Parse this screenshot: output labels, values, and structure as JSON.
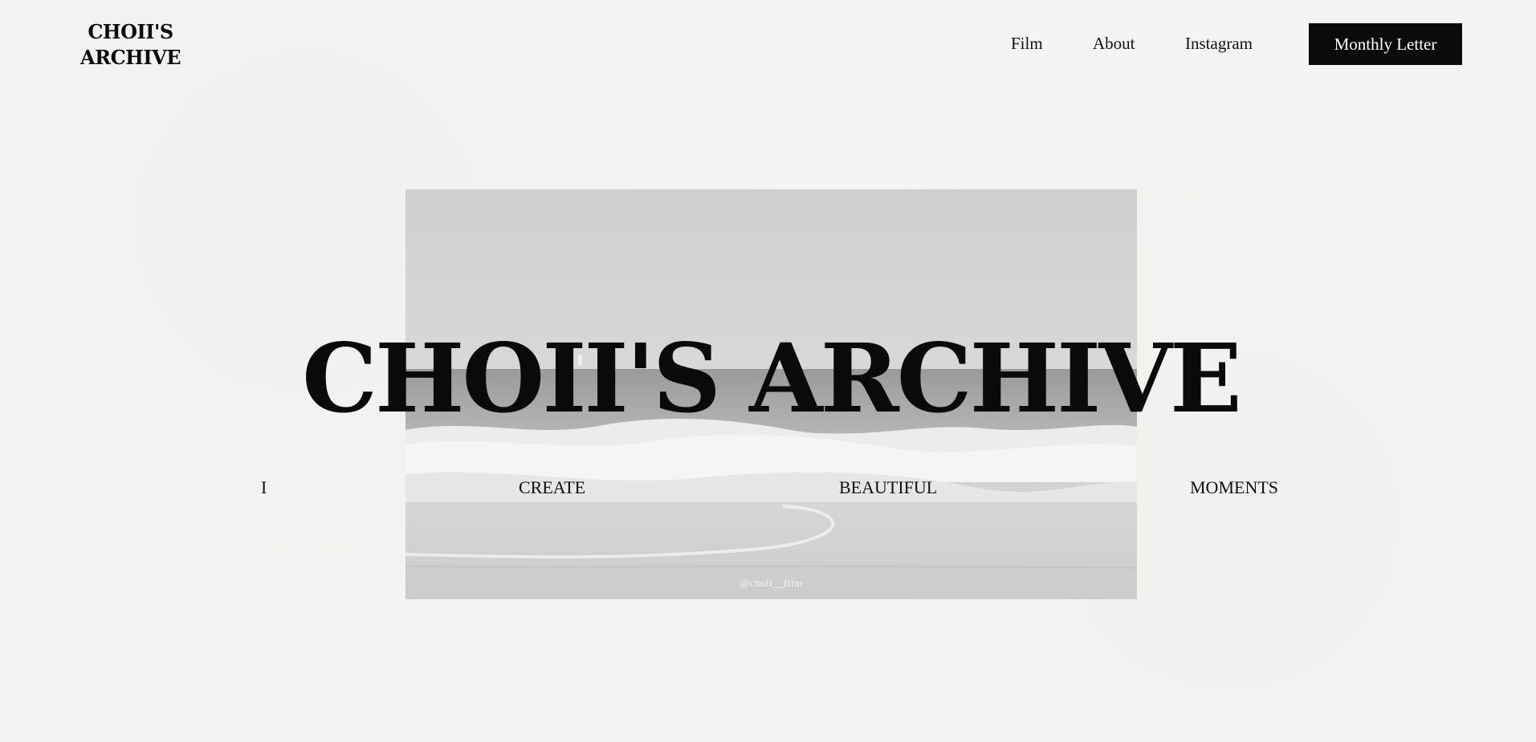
{
  "site": {
    "logo_line1": "CHOII'S",
    "logo_line2": "ARCHIVE"
  },
  "nav": {
    "items": [
      {
        "label": "Film"
      },
      {
        "label": "About"
      },
      {
        "label": "Instagram"
      }
    ],
    "cta_label": "Monthly Letter"
  },
  "hero": {
    "title": "CHOII'S ARCHIVE",
    "tagline_words": [
      "I",
      "CREATE",
      "BEAUTIFUL",
      "MOMENTS"
    ],
    "photo_credit": "@choii__film"
  },
  "colors": {
    "background": "#f4f4f3",
    "text": "#111111",
    "button_bg": "#0b0b0b",
    "button_text": "#ffffff"
  },
  "icons": {
    "hero_image": "ocean-wave-photo-icon"
  }
}
